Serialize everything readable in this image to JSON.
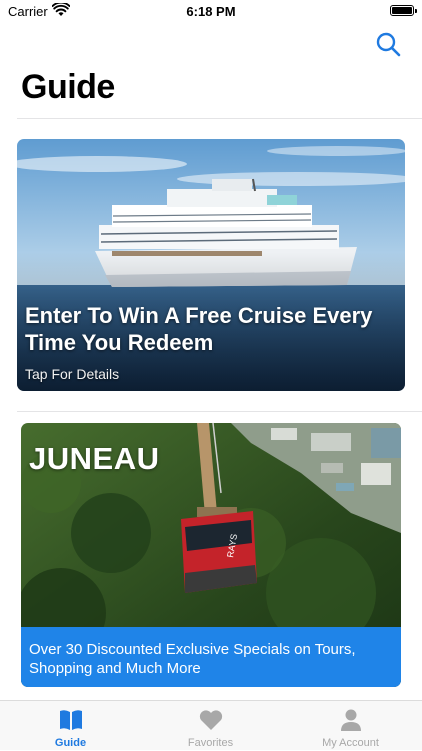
{
  "status_bar": {
    "carrier": "Carrier",
    "time": "6:18 PM"
  },
  "header": {
    "title": "Guide",
    "search_icon": "search-icon"
  },
  "cards": [
    {
      "title": "Enter To Win A Free Cruise Every Time You Redeem",
      "subtitle": "Tap For Details"
    },
    {
      "title": "JUNEAU",
      "banner_text": "Over 30 Discounted Exclusive Specials on Tours, Shopping and Much More"
    }
  ],
  "tab_bar": {
    "tabs": [
      {
        "label": "Guide",
        "icon": "book-icon",
        "active": true
      },
      {
        "label": "Favorites",
        "icon": "heart-icon",
        "active": false
      },
      {
        "label": "My Account",
        "icon": "person-icon",
        "active": false
      }
    ]
  },
  "colors": {
    "accent": "#1f7ae0",
    "banner": "#1f84e8",
    "inactive": "#a8a8a8"
  }
}
